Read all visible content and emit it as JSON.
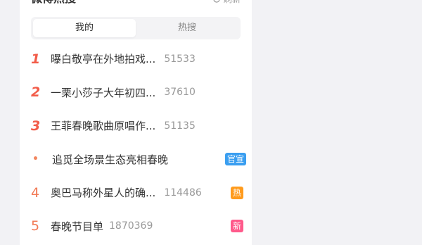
{
  "panel": {
    "title": "微博热搜",
    "refresh_label": "刷新"
  },
  "tabs": [
    {
      "label": "我的",
      "active": true
    },
    {
      "label": "热搜",
      "active": false
    }
  ],
  "items": [
    {
      "rank": "1",
      "title": "曝白敬亭在外地拍戏...",
      "count": "51533",
      "badge": ""
    },
    {
      "rank": "2",
      "title": "一栗小莎子大年初四...",
      "count": "37610",
      "badge": ""
    },
    {
      "rank": "3",
      "title": "王菲春晚歌曲原唱作...",
      "count": "51135",
      "badge": ""
    },
    {
      "rank": "•",
      "title": "追觅全场景生态亮相春晚",
      "count": "",
      "badge": "官宣"
    },
    {
      "rank": "4",
      "title": "奥巴马称外星人的确...",
      "count": "114486",
      "badge": "热"
    },
    {
      "rank": "5",
      "title": "春晚节目单",
      "count": "1870369",
      "badge": "新"
    }
  ],
  "colors": {
    "rank_top": "#f25c49",
    "badge_official": "#3a9ef0",
    "badge_hot": "#ff9b1d",
    "badge_new": "#ff5a8b"
  }
}
